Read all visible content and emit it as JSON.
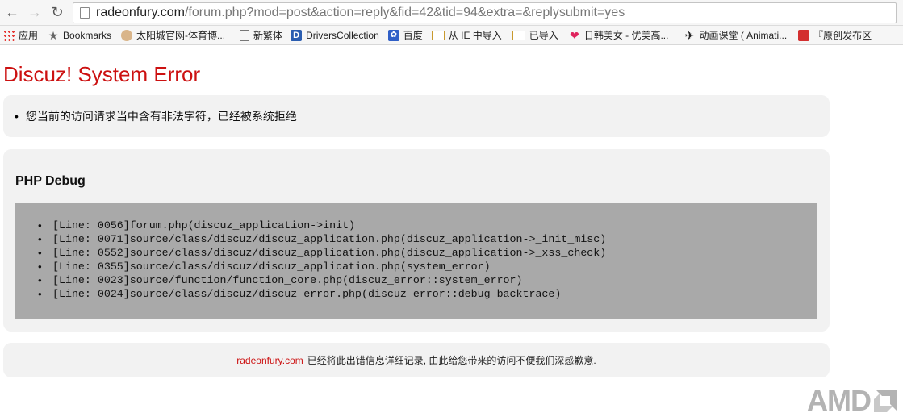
{
  "browser": {
    "url_host": "radeonfury.com",
    "url_path": "/forum.php?mod=post&action=reply&fid=42&tid=94&extra=&replysubmit=yes",
    "bookmarks": [
      {
        "label": "应用",
        "icon": "apps-icon"
      },
      {
        "label": "Bookmarks",
        "icon": "star-icon"
      },
      {
        "label": "太阳城官网-体育博...",
        "icon": "site-icon"
      },
      {
        "label": "新繁体",
        "icon": "page-icon"
      },
      {
        "label": "DriversCollection",
        "icon": "driverscollection-icon"
      },
      {
        "label": "百度",
        "icon": "baidu-paw-icon"
      },
      {
        "label": "从 IE 中导入",
        "icon": "folder-icon"
      },
      {
        "label": "已导入",
        "icon": "folder-icon"
      },
      {
        "label": "日韩美女 - 优美高...",
        "icon": "heart-icon"
      },
      {
        "label": "动画课堂 ( Animati...",
        "icon": "plane-icon"
      },
      {
        "label": "『原创发布区",
        "icon": "red-site-icon"
      }
    ]
  },
  "page": {
    "title": "Discuz! System Error",
    "message": "您当前的访问请求当中含有非法字符，已经被系统拒绝",
    "debug_heading": "PHP Debug",
    "trace": [
      "[Line: 0056]forum.php(discuz_application->init)",
      "[Line: 0071]source/class/discuz/discuz_application.php(discuz_application->_init_misc)",
      "[Line: 0552]source/class/discuz/discuz_application.php(discuz_application->_xss_check)",
      "[Line: 0355]source/class/discuz/discuz_application.php(system_error)",
      "[Line: 0023]source/function/function_core.php(discuz_error::system_error)",
      "[Line: 0024]source/class/discuz/discuz_error.php(discuz_error::debug_backtrace)"
    ],
    "footer_link": "radeonfury.com",
    "footer_text": "已经将此出错信息详细记录, 由此给您带来的访问不便我们深感歉意."
  },
  "watermark": {
    "text": "AMD"
  },
  "colors": {
    "error_red": "#cc1111",
    "panel_bg": "#f2f2f2",
    "trace_bg": "#a9a9a9"
  }
}
